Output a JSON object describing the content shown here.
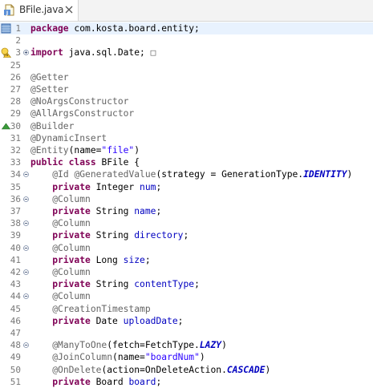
{
  "tab": {
    "label": "BFile.java"
  },
  "lines": [
    {
      "num": "1",
      "tokens": [
        {
          "t": "package",
          "c": "kw"
        },
        {
          "t": " com.kosta.board.entity;",
          "c": ""
        }
      ]
    },
    {
      "num": "2",
      "tokens": []
    },
    {
      "num": "3",
      "tokens": [
        {
          "t": "import",
          "c": "kw"
        },
        {
          "t": " java.sql.Date;",
          "c": ""
        },
        {
          "t": " □",
          "c": "ann"
        }
      ]
    },
    {
      "num": "25",
      "tokens": []
    },
    {
      "num": "26",
      "tokens": [
        {
          "t": "@Getter",
          "c": "ann"
        }
      ]
    },
    {
      "num": "27",
      "tokens": [
        {
          "t": "@Setter",
          "c": "ann"
        }
      ]
    },
    {
      "num": "28",
      "tokens": [
        {
          "t": "@NoArgsConstructor",
          "c": "ann"
        }
      ]
    },
    {
      "num": "29",
      "tokens": [
        {
          "t": "@AllArgsConstructor",
          "c": "ann"
        }
      ]
    },
    {
      "num": "30",
      "tokens": [
        {
          "t": "@Builder",
          "c": "ann"
        }
      ]
    },
    {
      "num": "31",
      "tokens": [
        {
          "t": "@DynamicInsert",
          "c": "ann"
        }
      ]
    },
    {
      "num": "32",
      "tokens": [
        {
          "t": "@Entity",
          "c": "ann"
        },
        {
          "t": "(name=",
          "c": ""
        },
        {
          "t": "\"file\"",
          "c": "str"
        },
        {
          "t": ")",
          "c": ""
        }
      ]
    },
    {
      "num": "33",
      "tokens": [
        {
          "t": "public",
          "c": "kw"
        },
        {
          "t": " ",
          "c": ""
        },
        {
          "t": "class",
          "c": "kw"
        },
        {
          "t": " BFile {",
          "c": ""
        }
      ]
    },
    {
      "num": "34",
      "tokens": [
        {
          "t": "    ",
          "c": ""
        },
        {
          "t": "@Id",
          "c": "ann"
        },
        {
          "t": " ",
          "c": ""
        },
        {
          "t": "@GeneratedValue",
          "c": "ann"
        },
        {
          "t": "(strategy = GenerationType.",
          "c": ""
        },
        {
          "t": "IDENTITY",
          "c": "sfld"
        },
        {
          "t": ")",
          "c": ""
        }
      ]
    },
    {
      "num": "35",
      "tokens": [
        {
          "t": "    ",
          "c": ""
        },
        {
          "t": "private",
          "c": "kw"
        },
        {
          "t": " Integer ",
          "c": ""
        },
        {
          "t": "num",
          "c": "fld"
        },
        {
          "t": ";",
          "c": ""
        }
      ]
    },
    {
      "num": "36",
      "tokens": [
        {
          "t": "    ",
          "c": ""
        },
        {
          "t": "@Column",
          "c": "ann"
        }
      ]
    },
    {
      "num": "37",
      "tokens": [
        {
          "t": "    ",
          "c": ""
        },
        {
          "t": "private",
          "c": "kw"
        },
        {
          "t": " String ",
          "c": ""
        },
        {
          "t": "name",
          "c": "fld"
        },
        {
          "t": ";",
          "c": ""
        }
      ]
    },
    {
      "num": "38",
      "tokens": [
        {
          "t": "    ",
          "c": ""
        },
        {
          "t": "@Column",
          "c": "ann"
        }
      ]
    },
    {
      "num": "39",
      "tokens": [
        {
          "t": "    ",
          "c": ""
        },
        {
          "t": "private",
          "c": "kw"
        },
        {
          "t": " String ",
          "c": ""
        },
        {
          "t": "directory",
          "c": "fld"
        },
        {
          "t": ";",
          "c": ""
        }
      ]
    },
    {
      "num": "40",
      "tokens": [
        {
          "t": "    ",
          "c": ""
        },
        {
          "t": "@Column",
          "c": "ann"
        }
      ]
    },
    {
      "num": "41",
      "tokens": [
        {
          "t": "    ",
          "c": ""
        },
        {
          "t": "private",
          "c": "kw"
        },
        {
          "t": " Long ",
          "c": ""
        },
        {
          "t": "size",
          "c": "fld"
        },
        {
          "t": ";",
          "c": ""
        }
      ]
    },
    {
      "num": "42",
      "tokens": [
        {
          "t": "    ",
          "c": ""
        },
        {
          "t": "@Column",
          "c": "ann"
        }
      ]
    },
    {
      "num": "43",
      "tokens": [
        {
          "t": "    ",
          "c": ""
        },
        {
          "t": "private",
          "c": "kw"
        },
        {
          "t": " String ",
          "c": ""
        },
        {
          "t": "contentType",
          "c": "fld"
        },
        {
          "t": ";",
          "c": ""
        }
      ]
    },
    {
      "num": "44",
      "tokens": [
        {
          "t": "    ",
          "c": ""
        },
        {
          "t": "@Column",
          "c": "ann"
        }
      ]
    },
    {
      "num": "45",
      "tokens": [
        {
          "t": "    ",
          "c": ""
        },
        {
          "t": "@CreationTimestamp",
          "c": "ann"
        }
      ]
    },
    {
      "num": "46",
      "tokens": [
        {
          "t": "    ",
          "c": ""
        },
        {
          "t": "private",
          "c": "kw"
        },
        {
          "t": " Date ",
          "c": ""
        },
        {
          "t": "uploadDate",
          "c": "fld"
        },
        {
          "t": ";",
          "c": ""
        }
      ]
    },
    {
      "num": "47",
      "tokens": []
    },
    {
      "num": "48",
      "tokens": [
        {
          "t": "    ",
          "c": ""
        },
        {
          "t": "@ManyToOne",
          "c": "ann"
        },
        {
          "t": "(fetch=FetchType.",
          "c": ""
        },
        {
          "t": "LAZY",
          "c": "sfld"
        },
        {
          "t": ")",
          "c": ""
        }
      ]
    },
    {
      "num": "49",
      "tokens": [
        {
          "t": "    ",
          "c": ""
        },
        {
          "t": "@JoinColumn",
          "c": "ann"
        },
        {
          "t": "(name=",
          "c": ""
        },
        {
          "t": "\"boardNum\"",
          "c": "str"
        },
        {
          "t": ")",
          "c": ""
        }
      ]
    },
    {
      "num": "50",
      "tokens": [
        {
          "t": "    ",
          "c": ""
        },
        {
          "t": "@OnDelete",
          "c": "ann"
        },
        {
          "t": "(action=OnDeleteAction.",
          "c": ""
        },
        {
          "t": "CASCADE",
          "c": "sfld"
        },
        {
          "t": ")",
          "c": ""
        }
      ]
    },
    {
      "num": "51",
      "tokens": [
        {
          "t": "    ",
          "c": ""
        },
        {
          "t": "private",
          "c": "kw"
        },
        {
          "t": " Board ",
          "c": ""
        },
        {
          "t": "board",
          "c": "fld"
        },
        {
          "t": ";",
          "c": ""
        }
      ]
    }
  ],
  "current_line": "1",
  "fold_lines": [
    "3",
    "34",
    "36",
    "38",
    "40",
    "42",
    "44",
    "48"
  ],
  "markers": {
    "1": "bookmark-icon",
    "3": "warning-lightbulb-icon",
    "30": "override-triangle-icon"
  },
  "colors": {
    "keyword": "#7f0055",
    "annotation": "#646464",
    "string": "#2a00ff",
    "field": "#0000c0",
    "current_line_bg": "#e8f2fe"
  }
}
